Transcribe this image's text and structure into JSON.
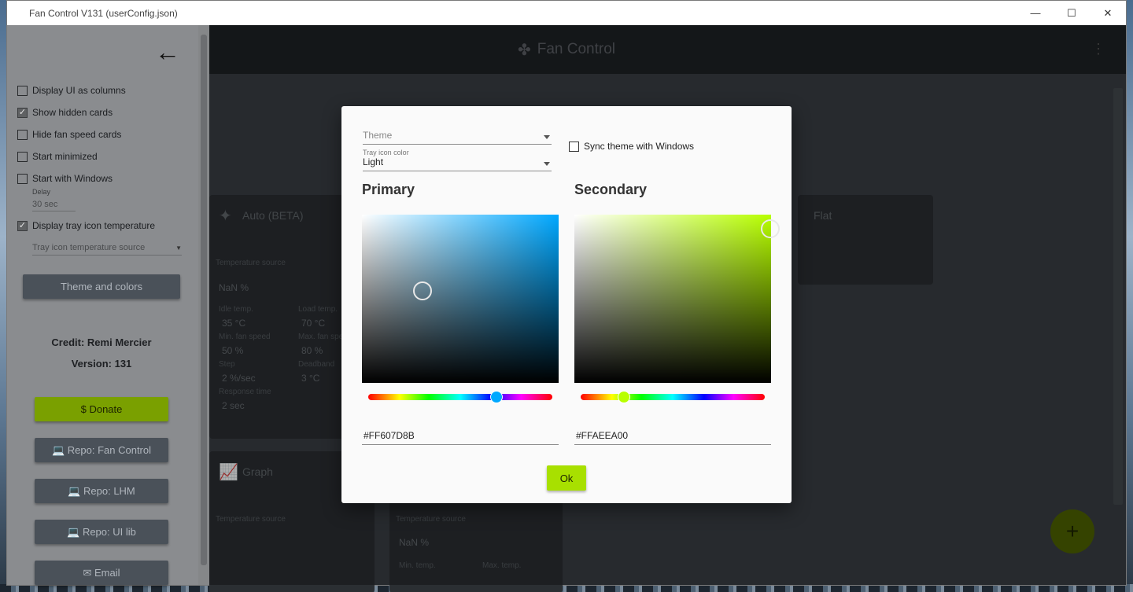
{
  "window": {
    "title": "Fan Control V131 (userConfig.json)",
    "minimize": "—",
    "maximize": "☐",
    "close": "✕"
  },
  "appbar": {
    "title": "Fan Control",
    "menu": "⋮"
  },
  "drawer": {
    "back": "←",
    "checkboxes": [
      {
        "label": "Display UI as columns",
        "checked": false
      },
      {
        "label": "Show hidden cards",
        "checked": true
      },
      {
        "label": "Hide fan speed cards",
        "checked": false
      },
      {
        "label": "Start minimized",
        "checked": false
      },
      {
        "label": "Start with Windows",
        "checked": false
      },
      {
        "label": "Display tray icon temperature",
        "checked": true
      }
    ],
    "delay_label": "Delay",
    "delay_value": "30 sec",
    "tray_source_placeholder": "Tray icon temperature source",
    "theme_button": "Theme and colors",
    "credit": "Credit: Remi Mercier",
    "version": "Version: 131",
    "donate": "$  Donate",
    "repo_fan_control": "💻  Repo: Fan Control",
    "repo_lhm": "💻  Repo: LHM",
    "repo_ui_lib": "💻  Repo: UI lib",
    "email": "✉  Email"
  },
  "cards": {
    "auto": {
      "title": "Auto (BETA)",
      "temp_source": "Temperature source",
      "nan": "NaN %",
      "fields": [
        {
          "label": "Idle temp.",
          "value": "35 °C"
        },
        {
          "label": "Load temp.",
          "value": "70 °C"
        },
        {
          "label": "Min. fan speed",
          "value": "50 %"
        },
        {
          "label": "Max. fan speed",
          "value": "80 %"
        },
        {
          "label": "Step",
          "value": "2 %/sec"
        },
        {
          "label": "Deadband",
          "value": "3 °C"
        },
        {
          "label": "Response time",
          "value": "2 sec"
        }
      ]
    },
    "flat": {
      "title": "Flat"
    },
    "graph": {
      "title": "Graph",
      "temp_source": "Temperature source"
    },
    "linear": {
      "temp_source": "Temperature source",
      "nan": "NaN %",
      "min_temp": "Min. temp.",
      "max_temp": "Max. temp."
    }
  },
  "fab": "+",
  "dialog": {
    "theme_placeholder": "Theme",
    "tray_color_label": "Tray icon color",
    "tray_color_value": "Light",
    "sync_label": "Sync theme with Windows",
    "primary_title": "Primary",
    "secondary_title": "Secondary",
    "primary_hex": "#FF607D8B",
    "secondary_hex": "#FFAEEA00",
    "primary_hue_color": "#00a8ff",
    "secondary_hue_color": "#b8ff00",
    "ok_label": "Ok"
  }
}
